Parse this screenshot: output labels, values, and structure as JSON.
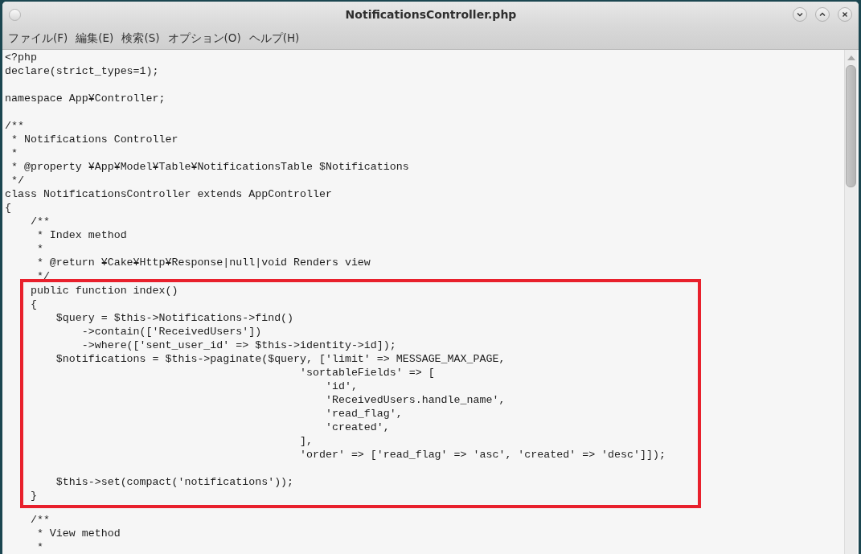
{
  "window": {
    "title": "NotificationsController.php"
  },
  "menu": [
    "ファイル(F)",
    "編集(E)",
    "検索(S)",
    "オプション(O)",
    "ヘルプ(H)"
  ],
  "editor": {
    "blocks_before": [
      [
        "<?php",
        "declare(strict_types=1);"
      ],
      [
        "namespace App¥Controller;"
      ],
      [
        "/**",
        " * Notifications Controller",
        " *",
        " * @property ¥App¥Model¥Table¥NotificationsTable $Notifications",
        " */",
        "class NotificationsController extends AppController",
        "{",
        "    /**",
        "     * Index method",
        "     *",
        "     * @return ¥Cake¥Http¥Response|null|void Renders view",
        "     */"
      ]
    ],
    "highlighted_blocks": [
      [
        "    public function index()",
        "    {",
        "        $query = $this->Notifications->find()",
        "            ->contain(['ReceivedUsers'])",
        "            ->where(['sent_user_id' => $this->identity->id]);",
        "        $notifications = $this->paginate($query, ['limit' => MESSAGE_MAX_PAGE,",
        "                                              'sortableFields' => [",
        "                                                  'id',",
        "                                                  'ReceivedUsers.handle_name',",
        "                                                  'read_flag',",
        "                                                  'created',",
        "                                              ],",
        "                                              'order' => ['read_flag' => 'asc', 'created' => 'desc']]);"
      ],
      [
        "        $this->set(compact('notifications'));",
        "    }"
      ]
    ],
    "blocks_after": [
      [
        "    /**",
        "     * View method",
        "     *"
      ]
    ]
  }
}
